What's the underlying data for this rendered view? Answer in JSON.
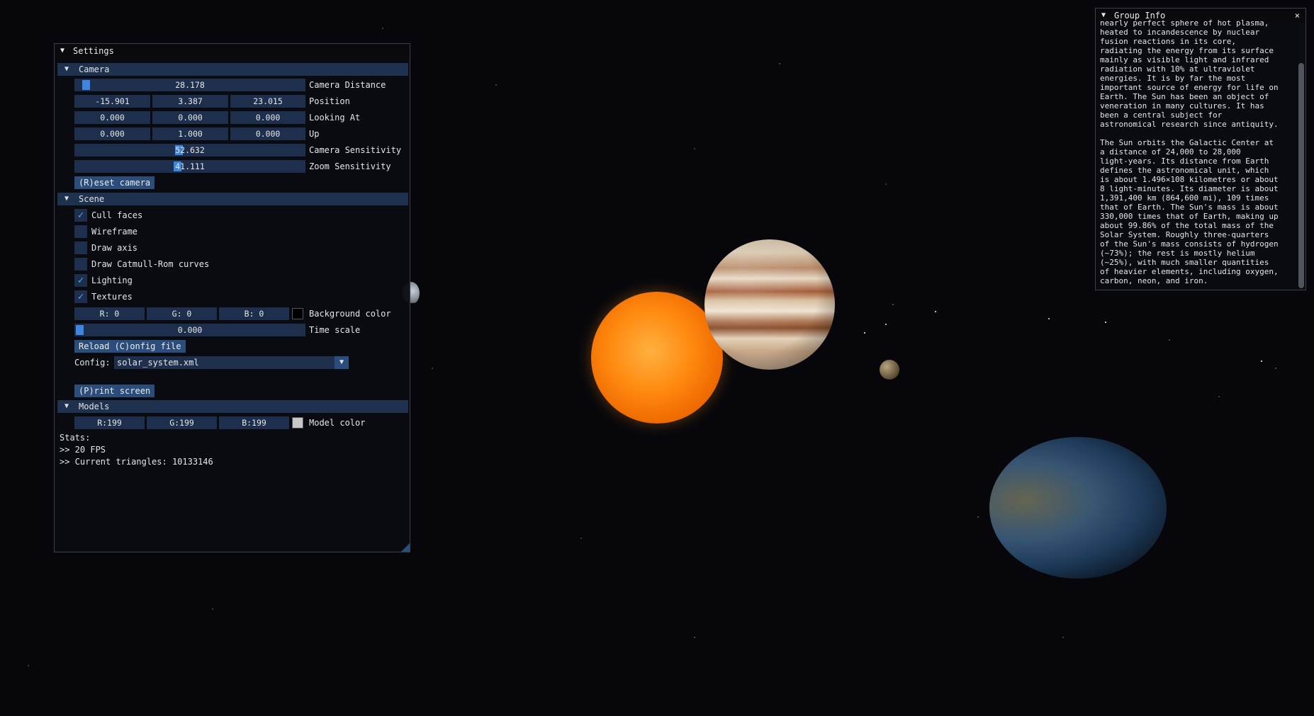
{
  "scene": {
    "background_color": "#07070b"
  },
  "settings": {
    "title": "Settings",
    "camera": {
      "header": "Camera",
      "distance": {
        "value": "28.178",
        "label": "Camera Distance"
      },
      "position": {
        "x": "-15.901",
        "y": "3.387",
        "z": "23.015",
        "label": "Position"
      },
      "looking_at": {
        "x": "0.000",
        "y": "0.000",
        "z": "0.000",
        "label": "Looking At"
      },
      "up": {
        "x": "0.000",
        "y": "1.000",
        "z": "0.000",
        "label": "Up"
      },
      "sensitivity": {
        "value": "52.632",
        "label": "Camera Sensitivity"
      },
      "zoom": {
        "value": "41.111",
        "label": "Zoom Sensitivity"
      },
      "reset_button": "(R)eset camera"
    },
    "scene": {
      "header": "Scene",
      "checkboxes": [
        {
          "label": "Cull faces",
          "checked": true
        },
        {
          "label": "Wireframe",
          "checked": false
        },
        {
          "label": "Draw axis",
          "checked": false
        },
        {
          "label": "Draw Catmull-Rom curves",
          "checked": false
        },
        {
          "label": "Lighting",
          "checked": true
        },
        {
          "label": "Textures",
          "checked": true
        }
      ],
      "bg_color": {
        "r": "R:  0",
        "g": "G:  0",
        "b": "B:  0",
        "label": "Background color",
        "swatch": "#000000"
      },
      "time_scale": {
        "value": "0.000",
        "label": "Time scale"
      },
      "reload_button": "Reload (C)onfig file",
      "config_label": "Config:",
      "config_value": "solar_system.xml",
      "print_button": "(P)rint screen"
    },
    "models": {
      "header": "Models",
      "color": {
        "r": "R:199",
        "g": "G:199",
        "b": "B:199",
        "label": "Model color",
        "swatch": "#c7c7c7"
      }
    },
    "stats": {
      "title": "Stats:",
      "fps": ">> 20 FPS",
      "triangles": ">> Current triangles: 10133146"
    }
  },
  "group_info": {
    "title": "Group Info",
    "close": "×",
    "text": "nearly perfect sphere of hot plasma,\nheated to incandescence by nuclear\nfusion reactions in its core,\nradiating the energy from its surface\nmainly as visible light and infrared\nradiation with 10% at ultraviolet\nenergies. It is by far the most\nimportant source of energy for life on\nEarth. The Sun has been an object of\nveneration in many cultures. It has\nbeen a central subject for\nastronomical research since antiquity.\n\nThe Sun orbits the Galactic Center at\na distance of 24,000 to 28,000\nlight-years. Its distance from Earth\ndefines the astronomical unit, which\nis about 1.496×108 kilometres or about\n8 light-minutes. Its diameter is about\n1,391,400 km (864,600 mi), 109 times\nthat of Earth. The Sun's mass is about\n330,000 times that of Earth, making up\nabout 99.86% of the total mass of the\nSolar System. Roughly three-quarters\nof the Sun's mass consists of hydrogen\n(~73%); the rest is mostly helium\n(~25%), with much smaller quantities\nof heavier elements, including oxygen,\ncarbon, neon, and iron."
  }
}
